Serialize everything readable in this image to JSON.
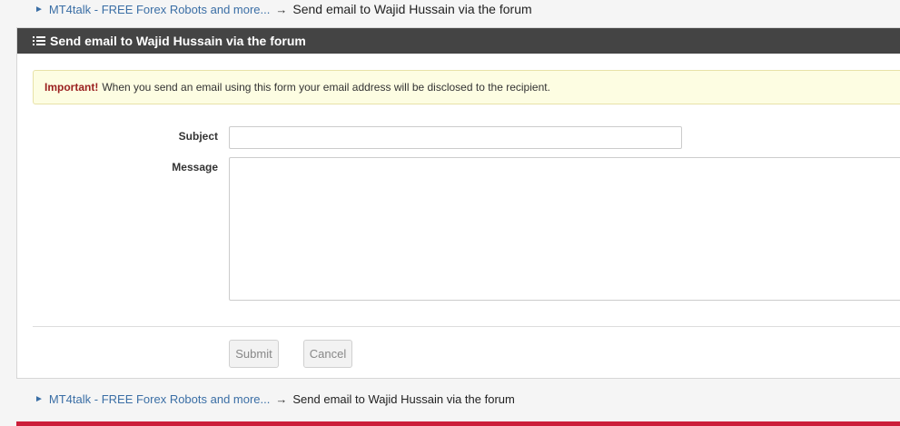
{
  "breadcrumb": {
    "triangle": "►",
    "home_link": "MT4talk - FREE Forex Robots and more...",
    "arrow": "→",
    "current": "Send email to Wajid Hussain via the forum"
  },
  "panel": {
    "icon": "list-icon",
    "title": "Send email to Wajid Hussain via the forum"
  },
  "notice": {
    "important": "Important!",
    "text": "When you send an email using this form your email address will be disclosed to the recipient."
  },
  "form": {
    "subject_label": "Subject",
    "subject_value": "",
    "message_label": "Message",
    "message_value": "",
    "submit_label": "Submit",
    "cancel_label": "Cancel"
  },
  "colors": {
    "header_bg": "#444444",
    "link": "#3a6ea5",
    "notice_bg": "#fdfde2",
    "important": "#9a1f1f",
    "footer_accent": "#cc1e3a"
  }
}
